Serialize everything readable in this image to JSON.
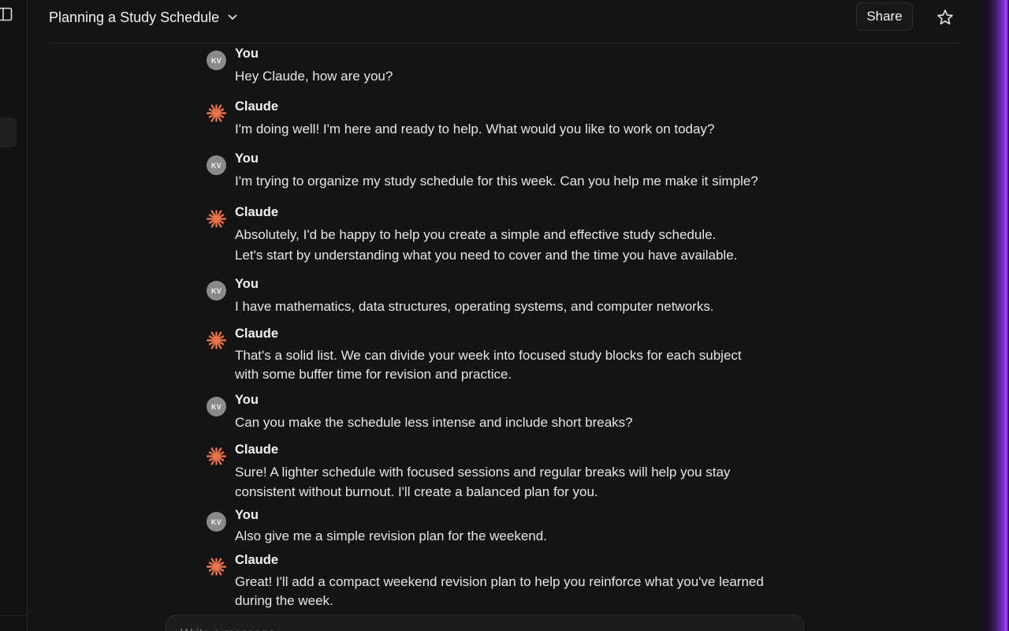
{
  "header": {
    "title": "Planning a Study Schedule",
    "share_label": "Share"
  },
  "icons": {
    "sidebar_toggle": "sidebar-toggle-icon",
    "title_menu": "chevron-down-icon",
    "favorite": "star-icon",
    "assistant": "claude-asterisk-icon"
  },
  "colors": {
    "claude_accent": "#e8734a",
    "user_avatar": "#8a8a8a",
    "edge_glow": "#a64dff"
  },
  "messages": [
    {
      "role": "user",
      "sender": "You",
      "avatar": "KV",
      "text": "Hey Claude, how are you?"
    },
    {
      "role": "assistant",
      "sender": "Claude",
      "text": "I'm doing well! I'm here and ready to help. What would you like to work on today?"
    },
    {
      "role": "user",
      "sender": "You",
      "avatar": "KV",
      "text": "I'm trying to organize my study schedule for this week. Can you help me make it simple?"
    },
    {
      "role": "assistant",
      "sender": "Claude",
      "lines": [
        "Absolutely, I'd be happy to help you create a simple and effective study schedule.",
        "Let's start by understanding what you need to cover and the time you have available."
      ]
    },
    {
      "role": "user",
      "sender": "You",
      "avatar": "KV",
      "text": "I have mathematics, data structures, operating systems, and computer networks."
    },
    {
      "role": "assistant",
      "sender": "Claude",
      "lines": [
        "That's a solid list. We can divide your week into focused study blocks for each subject",
        "with some buffer time for revision and practice."
      ]
    },
    {
      "role": "user",
      "sender": "You",
      "avatar": "KV",
      "text": "Can you make the schedule less intense and include short breaks?"
    },
    {
      "role": "assistant",
      "sender": "Claude",
      "lines": [
        "Sure! A lighter schedule with focused sessions and regular breaks will help you stay",
        "consistent without burnout. I'll create a balanced plan for you."
      ]
    },
    {
      "role": "user",
      "sender": "You",
      "avatar": "KV",
      "text": "Also give me a simple revision plan for the weekend."
    },
    {
      "role": "assistant",
      "sender": "Claude",
      "lines": [
        "Great! I'll add a compact weekend revision plan to help you reinforce what you've learned",
        "during the week."
      ]
    }
  ],
  "composer": {
    "placeholder": "Write a message...",
    "value": ""
  }
}
